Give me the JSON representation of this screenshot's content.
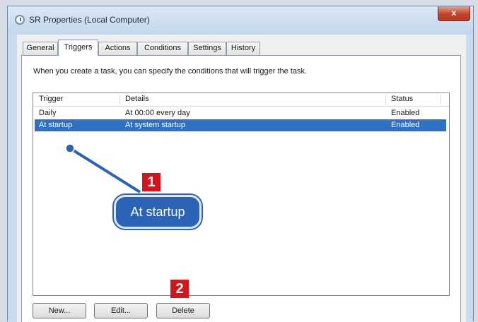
{
  "window": {
    "title": "SR Properties (Local Computer)",
    "close_label": "x"
  },
  "tabs": [
    {
      "label": "General"
    },
    {
      "label": "Triggers",
      "active": true
    },
    {
      "label": "Actions"
    },
    {
      "label": "Conditions"
    },
    {
      "label": "Settings"
    },
    {
      "label": "History"
    }
  ],
  "triggers": {
    "description": "When you create a task, you can specify the conditions that will trigger the task.",
    "columns": [
      "Trigger",
      "Details",
      "Status"
    ],
    "rows": [
      {
        "trigger": "Daily",
        "details": "At 00:00 every day",
        "status": "Enabled",
        "selected": false
      },
      {
        "trigger": "At startup",
        "details": "At system startup",
        "status": "Enabled",
        "selected": true
      }
    ]
  },
  "buttons": {
    "new": "New...",
    "edit": "Edit...",
    "delete": "Delete"
  },
  "annotations": {
    "badge1": "1",
    "badge2": "2",
    "callout": "At startup",
    "accent_color": "#d4161c",
    "callout_color": "#2b63b7"
  }
}
